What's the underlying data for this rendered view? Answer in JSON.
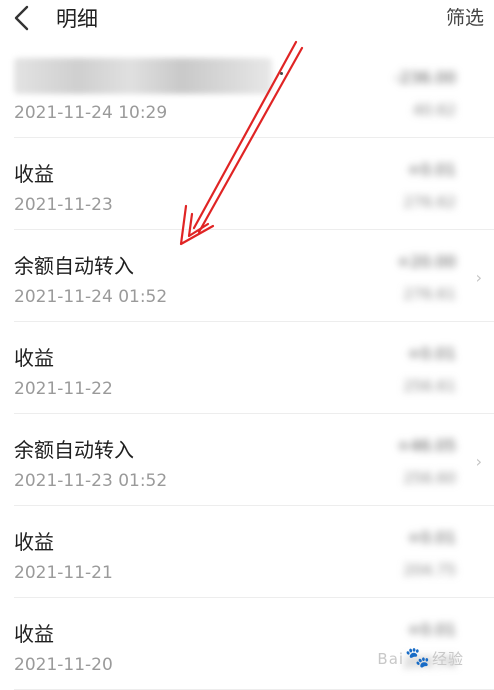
{
  "header": {
    "title": "明细",
    "filter_label": "筛选"
  },
  "rows": [
    {
      "name": "",
      "date": "2021-11-24 10:29",
      "amount": "-236.00",
      "balance": "40.62",
      "redacted": true
    },
    {
      "name": "收益",
      "date": "2021-11-23",
      "amount": "+0.01",
      "balance": "276.62"
    },
    {
      "name": "余额自动转入",
      "date": "2021-11-24 01:52",
      "amount": "+20.00",
      "balance": "276.61"
    },
    {
      "name": "收益",
      "date": "2021-11-22",
      "amount": "+0.01",
      "balance": "256.61"
    },
    {
      "name": "余额自动转入",
      "date": "2021-11-23 01:52",
      "amount": "+46.05",
      "balance": "256.60"
    },
    {
      "name": "收益",
      "date": "2021-11-21",
      "amount": "+0.01",
      "balance": "204.75"
    },
    {
      "name": "收益",
      "date": "2021-11-20",
      "amount": "+0.01",
      "balance": "204.74"
    }
  ],
  "icons": {
    "back": "chevron-left-icon",
    "row_arrow": "chevron-right-icon"
  },
  "annotation_color": "#e02424",
  "watermark": {
    "brand_left": "Bai",
    "brand_right": "经验"
  }
}
